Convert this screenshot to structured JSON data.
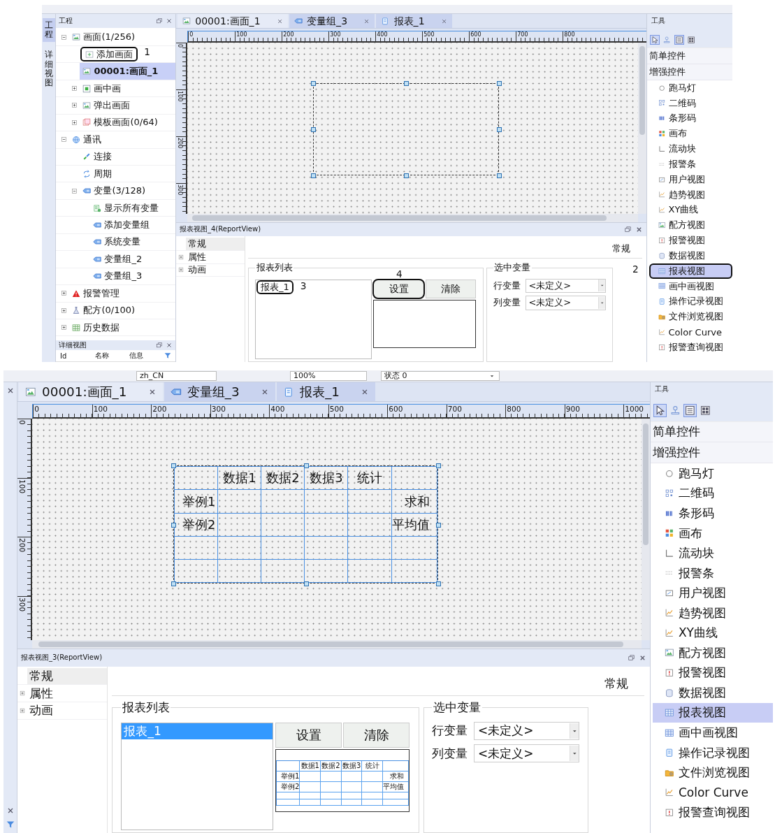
{
  "screens": [
    {
      "side_tabs": [
        {
          "label": "工程",
          "selected": true
        },
        {
          "label": "详细视图",
          "selected": false
        }
      ],
      "project_panel": {
        "title": "工程",
        "tree": [
          {
            "label": "画面(1/256)",
            "kind": "screens",
            "selected": false,
            "expanded": true,
            "children": [
              {
                "label": "添加画面",
                "kind": "add",
                "selected": false,
                "callout": "1"
              },
              {
                "label": "00001:画面_1",
                "kind": "screen",
                "selected": true
              },
              {
                "label": "画中画",
                "kind": "pip",
                "selected": false,
                "expanded": false
              },
              {
                "label": "弹出画面",
                "kind": "popup",
                "selected": false,
                "expanded": false
              },
              {
                "label": "模板画面(0/64)",
                "kind": "template",
                "selected": false,
                "expanded": false
              }
            ]
          },
          {
            "label": "通讯",
            "kind": "comm",
            "selected": false,
            "expanded": true,
            "children": [
              {
                "label": "连接",
                "kind": "link",
                "selected": false
              },
              {
                "label": "周期",
                "kind": "cycle",
                "selected": false
              },
              {
                "label": "变量(3/128)",
                "kind": "vars",
                "selected": false,
                "expanded": true,
                "children": [
                  {
                    "label": "显示所有变量",
                    "kind": "show_all",
                    "selected": false
                  },
                  {
                    "label": "添加变量组",
                    "kind": "group",
                    "selected": false
                  },
                  {
                    "label": "系统变量",
                    "kind": "group",
                    "selected": false
                  },
                  {
                    "label": "变量组_2",
                    "kind": "group",
                    "selected": false
                  },
                  {
                    "label": "变量组_3",
                    "kind": "group",
                    "selected": false
                  }
                ]
              }
            ]
          },
          {
            "label": "报警管理",
            "kind": "alarm",
            "selected": false,
            "expanded": false
          },
          {
            "label": "配方(0/100)",
            "kind": "recipe",
            "selected": false,
            "expanded": false
          },
          {
            "label": "历史数据",
            "kind": "history",
            "selected": false,
            "expanded": false
          }
        ],
        "detail_panel": {
          "title": "详细视图",
          "columns": [
            "Id",
            "名称",
            "信息"
          ]
        }
      },
      "tabs": [
        {
          "label": "00001:画面_1",
          "kind": "screen",
          "selected": true
        },
        {
          "label": "变量组_3",
          "kind": "variables",
          "selected": false
        },
        {
          "label": "报表_1",
          "kind": "report",
          "selected": false
        }
      ],
      "ruler": {
        "x_labels": [
          "0",
          "100",
          "200",
          "300",
          "400",
          "500",
          "600",
          "700",
          "800"
        ],
        "y_labels": [
          "0",
          "100",
          "200",
          "300"
        ]
      },
      "canvas": {
        "report_frame": {
          "selected": true
        }
      },
      "report_view": {
        "title": "报表视图_4(ReportView)",
        "nav": [
          {
            "label": "常规",
            "selected": true
          },
          {
            "label": "属性",
            "selected": false,
            "expanded": false
          },
          {
            "label": "动画",
            "selected": false,
            "expanded": false
          }
        ],
        "heading": "常规",
        "report_list": {
          "title": "报表列表",
          "items": [
            {
              "label": "报表_1",
              "selected": false,
              "callout": "3"
            }
          ]
        },
        "buttons": [
          {
            "label": "设置",
            "callout": "4"
          },
          {
            "label": "清除"
          }
        ],
        "selected_variables": {
          "title": "选中变量",
          "fields": [
            {
              "label": "行变量",
              "value": "<未定义>"
            },
            {
              "label": "列变量",
              "value": "<未定义>"
            }
          ]
        }
      },
      "toolbox": {
        "title": "工具",
        "tools": [
          {
            "kind": "pointer",
            "selected": true
          },
          {
            "kind": "stamp",
            "selected": false
          },
          {
            "kind": "list_tool",
            "selected": true
          },
          {
            "kind": "grid",
            "selected": false
          }
        ],
        "categories": [
          {
            "label": "简单控件"
          },
          {
            "label": "增强控件"
          }
        ],
        "items": [
          {
            "label": "跑马灯",
            "kind": "marquee",
            "selected": false
          },
          {
            "label": "二维码",
            "kind": "qrcode",
            "selected": false
          },
          {
            "label": "条形码",
            "kind": "barcode",
            "selected": false
          },
          {
            "label": "画布",
            "kind": "canvas",
            "selected": false
          },
          {
            "label": "流动块",
            "kind": "flow",
            "selected": false
          },
          {
            "label": "报警条",
            "kind": "alarm_bar",
            "selected": false
          },
          {
            "label": "用户视图",
            "kind": "user_view",
            "selected": false
          },
          {
            "label": "趋势视图",
            "kind": "trend",
            "selected": false
          },
          {
            "label": "XY曲线",
            "kind": "xy",
            "selected": false
          },
          {
            "label": "配方视图",
            "kind": "recipe_view",
            "selected": false
          },
          {
            "label": "报警视图",
            "kind": "alarm_view",
            "selected": false
          },
          {
            "label": "数据视图",
            "kind": "data_view",
            "selected": false
          },
          {
            "label": "报表视图",
            "kind": "report_view",
            "selected": true,
            "callout": "2"
          },
          {
            "label": "画中画视图",
            "kind": "pip_view",
            "selected": false
          },
          {
            "label": "操作记录视图",
            "kind": "op_log",
            "selected": false
          },
          {
            "label": "文件浏览视图",
            "kind": "file_browser",
            "selected": false
          },
          {
            "label": "Color Curve",
            "kind": "color_curve",
            "selected": false
          },
          {
            "label": "报警查询视图",
            "kind": "alarm_query",
            "selected": false
          }
        ]
      }
    },
    {
      "toolbar": {
        "language": "zh_CN",
        "zoom": "100%",
        "state": "状态 0"
      },
      "tabs": [
        {
          "label": "00001:画面_1",
          "kind": "screen",
          "selected": true
        },
        {
          "label": "变量组_3",
          "kind": "variables",
          "selected": false
        },
        {
          "label": "报表_1",
          "kind": "report",
          "selected": false
        }
      ],
      "ruler": {
        "x_labels": [
          "0",
          "100",
          "200",
          "300",
          "400",
          "500",
          "600",
          "700",
          "800",
          "900",
          "1000"
        ],
        "y_labels": [
          "0",
          "100",
          "200",
          "300"
        ]
      },
      "canvas": {
        "report_frame": {
          "selected": true,
          "table": {
            "columns": [
              "数据1",
              "数据2",
              "数据3",
              "统计"
            ],
            "rows": [
              {
                "label": "举例1",
                "summary": "求和"
              },
              {
                "label": "举例2",
                "summary": "平均值"
              },
              {},
              {}
            ]
          }
        }
      },
      "report_view": {
        "title": "报表视图_3(ReportView)",
        "nav": [
          {
            "label": "常规",
            "selected": true
          },
          {
            "label": "属性",
            "selected": false,
            "expanded": false
          },
          {
            "label": "动画",
            "selected": false,
            "expanded": false
          }
        ],
        "heading": "常规",
        "report_list": {
          "title": "报表列表",
          "items": [
            {
              "label": "报表_1",
              "selected": true
            }
          ]
        },
        "buttons": [
          {
            "label": "设置"
          },
          {
            "label": "清除"
          }
        ],
        "preview": {
          "columns": [
            "数据1",
            "数据2",
            "数据3",
            "统计"
          ],
          "rows": [
            {
              "label": "举例1",
              "summary": "求和"
            },
            {
              "label": "举例2",
              "summary": "平均值"
            },
            {},
            {}
          ]
        },
        "selected_variables": {
          "title": "选中变量",
          "fields": [
            {
              "label": "行变量",
              "value": "<未定义>"
            },
            {
              "label": "列变量",
              "value": "<未定义>"
            }
          ]
        }
      },
      "toolbox": {
        "title": "工具",
        "tools": [
          {
            "kind": "pointer",
            "selected": true
          },
          {
            "kind": "stamp",
            "selected": false
          },
          {
            "kind": "list_tool",
            "selected": true
          },
          {
            "kind": "grid",
            "selected": false
          }
        ],
        "categories": [
          {
            "label": "简单控件"
          },
          {
            "label": "增强控件"
          }
        ],
        "items": [
          {
            "label": "跑马灯",
            "kind": "marquee",
            "selected": false
          },
          {
            "label": "二维码",
            "kind": "qrcode",
            "selected": false
          },
          {
            "label": "条形码",
            "kind": "barcode",
            "selected": false
          },
          {
            "label": "画布",
            "kind": "canvas",
            "selected": false
          },
          {
            "label": "流动块",
            "kind": "flow",
            "selected": false
          },
          {
            "label": "报警条",
            "kind": "alarm_bar",
            "selected": false
          },
          {
            "label": "用户视图",
            "kind": "user_view",
            "selected": false
          },
          {
            "label": "趋势视图",
            "kind": "trend",
            "selected": false
          },
          {
            "label": "XY曲线",
            "kind": "xy",
            "selected": false
          },
          {
            "label": "配方视图",
            "kind": "recipe_view",
            "selected": false
          },
          {
            "label": "报警视图",
            "kind": "alarm_view",
            "selected": false
          },
          {
            "label": "数据视图",
            "kind": "data_view",
            "selected": false
          },
          {
            "label": "报表视图",
            "kind": "report_view",
            "selected": true
          },
          {
            "label": "画中画视图",
            "kind": "pip_view",
            "selected": false
          },
          {
            "label": "操作记录视图",
            "kind": "op_log",
            "selected": false
          },
          {
            "label": "文件浏览视图",
            "kind": "file_browser",
            "selected": false
          },
          {
            "label": "Color Curve",
            "kind": "color_curve",
            "selected": false
          },
          {
            "label": "报警查询视图",
            "kind": "alarm_query",
            "selected": false
          }
        ]
      }
    }
  ]
}
